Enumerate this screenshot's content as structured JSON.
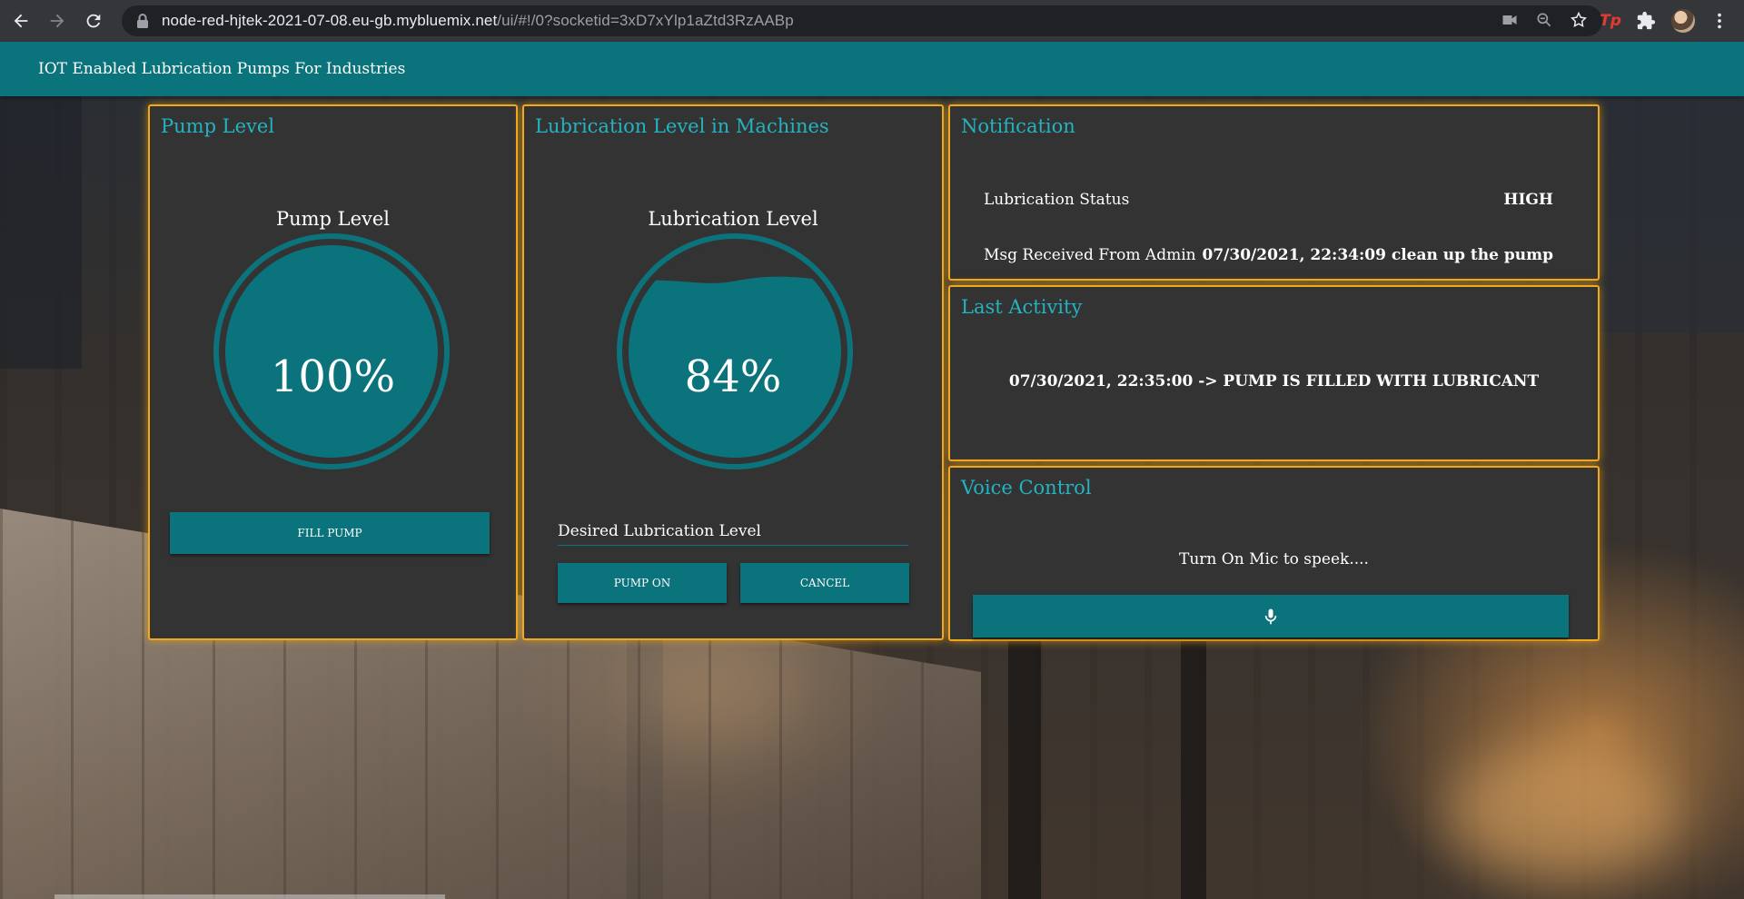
{
  "browser": {
    "url_host": "node-red-hjtek-2021-07-08.eu-gb.mybluemix.net",
    "url_path": "/ui/#!/0?socketid=3xD7xYlp1aZtd3RzAABp",
    "extension_label": "Tp"
  },
  "app": {
    "title": "IOT Enabled Lubrication Pumps For Industries",
    "accent": "#0b737b",
    "title_color": "#23b3c1",
    "border_color": "#f0a81c"
  },
  "pump_card": {
    "title": "Pump Level",
    "gauge_label": "Pump Level",
    "gauge_value": "100%",
    "fill_fraction": 1.0,
    "button_label": "FILL PUMP"
  },
  "lubrication_card": {
    "title": "Lubrication Level in Machines",
    "gauge_label": "Lubrication Level",
    "gauge_value": "84%",
    "fill_fraction": 0.84,
    "input_label": "Desired Lubrication Level",
    "pump_on_label": "PUMP ON",
    "cancel_label": "CANCEL"
  },
  "notification_card": {
    "title": "Notification",
    "rows": [
      {
        "label": "Lubrication Status",
        "value": "HIGH"
      },
      {
        "label": "Msg Received From Admin",
        "value": "07/30/2021, 22:34:09 clean up the pump"
      }
    ]
  },
  "activity_card": {
    "title": "Last Activity",
    "text": "07/30/2021, 22:35:00 -> PUMP IS FILLED WITH LUBRICANT"
  },
  "voice_card": {
    "title": "Voice Control",
    "text": "Turn On Mic to speek....",
    "button_icon": "microphone-icon"
  }
}
